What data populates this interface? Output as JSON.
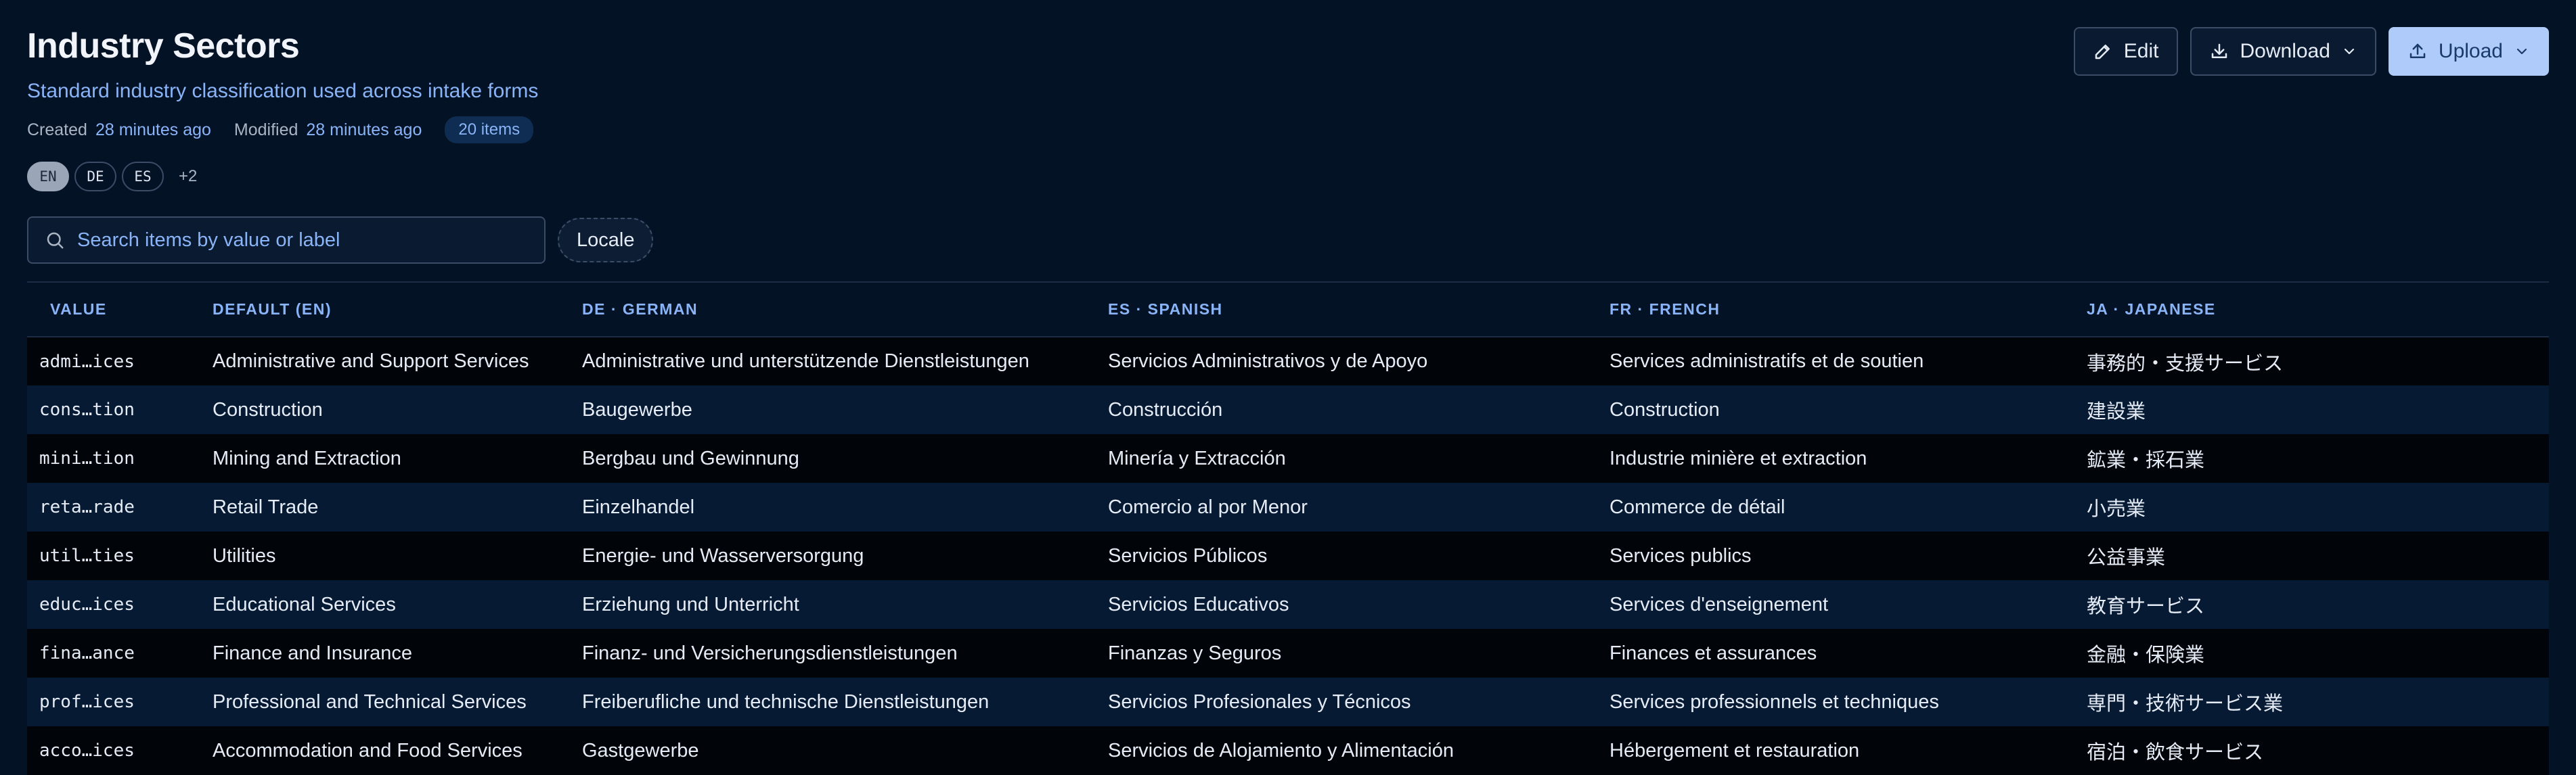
{
  "header": {
    "title": "Industry Sectors",
    "subtitle": "Standard industry classification used across intake forms",
    "created_label": "Created",
    "created_value": "28 minutes ago",
    "modified_label": "Modified",
    "modified_value": "28 minutes ago",
    "item_count": "20 items"
  },
  "locales": {
    "chips": [
      "EN",
      "DE",
      "ES"
    ],
    "more": "+2"
  },
  "actions": {
    "edit_label": "Edit",
    "download_label": "Download",
    "upload_label": "Upload"
  },
  "search": {
    "placeholder": "Search items by value or label"
  },
  "filter": {
    "locale_label": "Locale"
  },
  "table": {
    "columns": [
      "VALUE",
      "DEFAULT (EN)",
      "DE · GERMAN",
      "ES · SPANISH",
      "FR · FRENCH",
      "JA · JAPANESE"
    ],
    "rows": [
      [
        "admi…ices",
        "Administrative and Support Services",
        "Administrative und unterstützende Dienstleistungen",
        "Servicios Administrativos y de Apoyo",
        "Services administratifs et de soutien",
        "事務的・支援サービス"
      ],
      [
        "cons…tion",
        "Construction",
        "Baugewerbe",
        "Construcción",
        "Construction",
        "建設業"
      ],
      [
        "mini…tion",
        "Mining and Extraction",
        "Bergbau und Gewinnung",
        "Minería y Extracción",
        "Industrie minière et extraction",
        "鉱業・採石業"
      ],
      [
        "reta…rade",
        "Retail Trade",
        "Einzelhandel",
        "Comercio al por Menor",
        "Commerce de détail",
        "小売業"
      ],
      [
        "util…ties",
        "Utilities",
        "Energie- und Wasserversorgung",
        "Servicios Públicos",
        "Services publics",
        "公益事業"
      ],
      [
        "educ…ices",
        "Educational Services",
        "Erziehung und Unterricht",
        "Servicios Educativos",
        "Services d'enseignement",
        "教育サービス"
      ],
      [
        "fina…ance",
        "Finance and Insurance",
        "Finanz- und Versicherungsdienstleistungen",
        "Finanzas y Seguros",
        "Finances et assurances",
        "金融・保険業"
      ],
      [
        "prof…ices",
        "Professional and Technical Services",
        "Freiberufliche und technische Dienstleistungen",
        "Servicios Profesionales y Técnicos",
        "Services professionnels et techniques",
        "専門・技術サービス業"
      ],
      [
        "acco…ices",
        "Accommodation and Food Services",
        "Gastgewerbe",
        "Servicios de Alojamiento y Alimentación",
        "Hébergement et restauration",
        "宿泊・飲食サービス"
      ]
    ]
  },
  "colors": {
    "background": "#041226",
    "accent": "#8ab4f8",
    "primary_button": "#aecbfa"
  },
  "icons": {
    "edit": "pencil-icon",
    "download": "download-icon",
    "upload": "upload-icon",
    "search": "search-icon",
    "dropdown": "chevron-down-icon"
  }
}
